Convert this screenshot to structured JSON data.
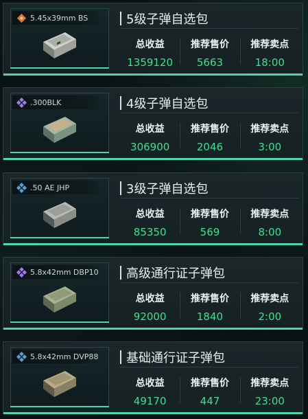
{
  "stat_labels": {
    "total_profit": "总收益",
    "recommended_price": "推荐售价",
    "recommended_time": "推荐卖点"
  },
  "colors": {
    "accent": "#4fd6a8",
    "value_green": "#3ee08f",
    "tier_orange": "#e5713a",
    "tier_purple": "#a678e8",
    "tier_blue": "#4da3e0"
  },
  "cards": [
    {
      "item_name": "5.45x39mm BS",
      "rarity_icon": "orange-diamond-icon",
      "title": "5级子弹自选包",
      "total_profit": "1359120",
      "recommended_price": "5663",
      "recommended_time": "18:00"
    },
    {
      "item_name": ".300BLK",
      "rarity_icon": "purple-diamond-icon",
      "title": "4级子弹自选包",
      "total_profit": "306900",
      "recommended_price": "2046",
      "recommended_time": "3:00"
    },
    {
      "item_name": ".50 AE JHP",
      "rarity_icon": "blue-diamond-icon",
      "title": "3级子弹自选包",
      "total_profit": "85350",
      "recommended_price": "569",
      "recommended_time": "8:00"
    },
    {
      "item_name": "5.8x42mm DBP10",
      "rarity_icon": "purple-diamond-icon",
      "title": "高级通行证子弹包",
      "total_profit": "92000",
      "recommended_price": "1840",
      "recommended_time": "2:00"
    },
    {
      "item_name": "5.8x42mm DVP88",
      "rarity_icon": "blue-diamond-icon",
      "title": "基础通行证子弹包",
      "total_profit": "49170",
      "recommended_price": "447",
      "recommended_time": "23:00"
    }
  ]
}
